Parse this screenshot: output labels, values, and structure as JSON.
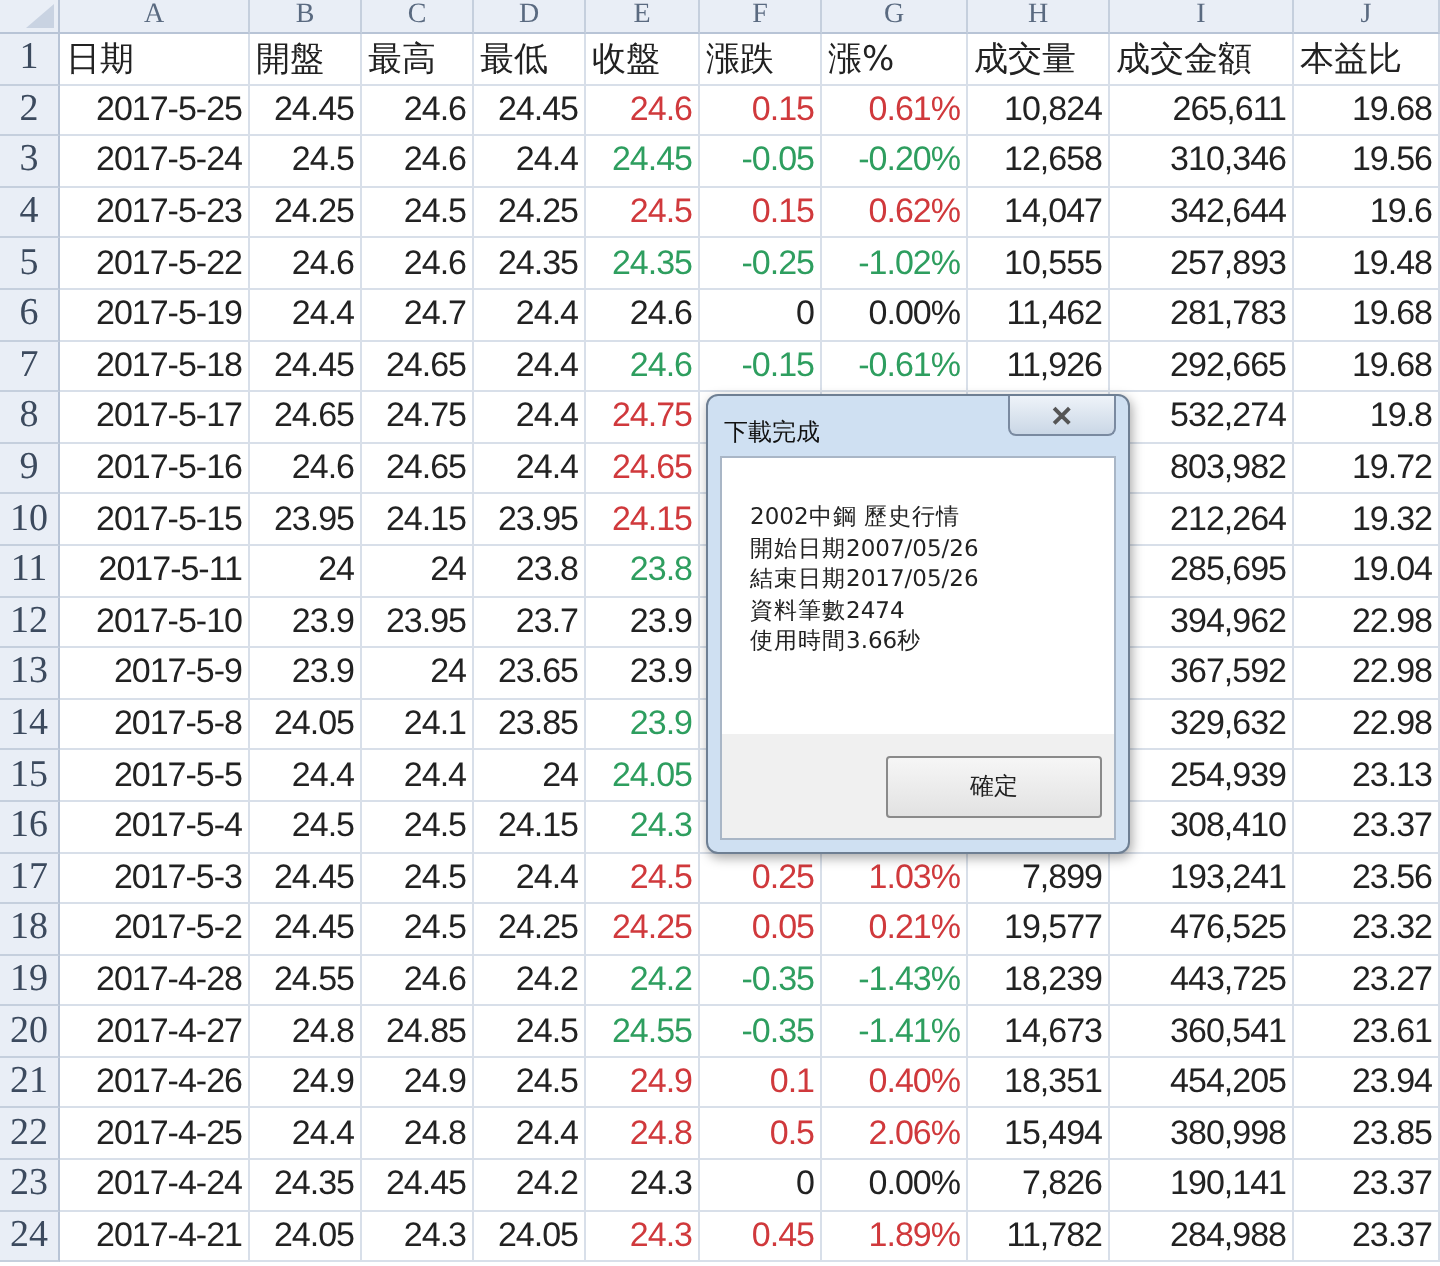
{
  "column_headers": [
    "A",
    "B",
    "C",
    "D",
    "E",
    "F",
    "G",
    "H",
    "I",
    "J"
  ],
  "header_row": {
    "number": "1",
    "cells": [
      "日期",
      "開盤",
      "最高",
      "最低",
      "收盤",
      "漲跌",
      "漲%",
      "成交量",
      "成交金額",
      "本益比"
    ]
  },
  "rows": [
    {
      "number": "2",
      "color": "#d0393c",
      "cells": [
        "2017-5-25",
        "24.45",
        "24.6",
        "24.45",
        "24.6",
        "0.15",
        "0.61%",
        "10,824",
        "265,611",
        "19.68"
      ]
    },
    {
      "number": "3",
      "color": "#2e9e5f",
      "cells": [
        "2017-5-24",
        "24.5",
        "24.6",
        "24.4",
        "24.45",
        "-0.05",
        "-0.20%",
        "12,658",
        "310,346",
        "19.56"
      ]
    },
    {
      "number": "4",
      "color": "#d0393c",
      "cells": [
        "2017-5-23",
        "24.25",
        "24.5",
        "24.25",
        "24.5",
        "0.15",
        "0.62%",
        "14,047",
        "342,644",
        "19.6"
      ]
    },
    {
      "number": "5",
      "color": "#2e9e5f",
      "cells": [
        "2017-5-22",
        "24.6",
        "24.6",
        "24.35",
        "24.35",
        "-0.25",
        "-1.02%",
        "10,555",
        "257,893",
        "19.48"
      ]
    },
    {
      "number": "6",
      "color": "#222222",
      "cells": [
        "2017-5-19",
        "24.4",
        "24.7",
        "24.4",
        "24.6",
        "0",
        "0.00%",
        "11,462",
        "281,783",
        "19.68"
      ]
    },
    {
      "number": "7",
      "color": "#2e9e5f",
      "cells": [
        "2017-5-18",
        "24.45",
        "24.65",
        "24.4",
        "24.6",
        "-0.15",
        "-0.61%",
        "11,926",
        "292,665",
        "19.68"
      ]
    },
    {
      "number": "8",
      "color": "#d0393c",
      "cells": [
        "2017-5-17",
        "24.65",
        "24.75",
        "24.4",
        "24.75",
        null,
        null,
        null,
        "532,274",
        "19.8"
      ]
    },
    {
      "number": "9",
      "color": "#d0393c",
      "cells": [
        "2017-5-16",
        "24.6",
        "24.65",
        "24.4",
        "24.65",
        null,
        null,
        null,
        "803,982",
        "19.72"
      ]
    },
    {
      "number": "10",
      "color": "#d0393c",
      "cells": [
        "2017-5-15",
        "23.95",
        "24.15",
        "23.95",
        "24.15",
        null,
        null,
        null,
        "212,264",
        "19.32"
      ]
    },
    {
      "number": "11",
      "color": "#2e9e5f",
      "cells": [
        "2017-5-11",
        "24",
        "24",
        "23.8",
        "23.8",
        null,
        null,
        null,
        "285,695",
        "19.04"
      ]
    },
    {
      "number": "12",
      "color": "#222222",
      "cells": [
        "2017-5-10",
        "23.9",
        "23.95",
        "23.7",
        "23.9",
        null,
        null,
        null,
        "394,962",
        "22.98"
      ]
    },
    {
      "number": "13",
      "color": "#222222",
      "cells": [
        "2017-5-9",
        "23.9",
        "24",
        "23.65",
        "23.9",
        null,
        null,
        null,
        "367,592",
        "22.98"
      ]
    },
    {
      "number": "14",
      "color": "#2e9e5f",
      "cells": [
        "2017-5-8",
        "24.05",
        "24.1",
        "23.85",
        "23.9",
        null,
        null,
        null,
        "329,632",
        "22.98"
      ]
    },
    {
      "number": "15",
      "color": "#2e9e5f",
      "cells": [
        "2017-5-5",
        "24.4",
        "24.4",
        "24",
        "24.05",
        null,
        null,
        null,
        "254,939",
        "23.13"
      ]
    },
    {
      "number": "16",
      "color": "#2e9e5f",
      "cells": [
        "2017-5-4",
        "24.5",
        "24.5",
        "24.15",
        "24.3",
        null,
        null,
        null,
        "308,410",
        "23.37"
      ]
    },
    {
      "number": "17",
      "color": "#d0393c",
      "cells": [
        "2017-5-3",
        "24.45",
        "24.5",
        "24.4",
        "24.5",
        "0.25",
        "1.03%",
        "7,899",
        "193,241",
        "23.56"
      ]
    },
    {
      "number": "18",
      "color": "#d0393c",
      "cells": [
        "2017-5-2",
        "24.45",
        "24.5",
        "24.25",
        "24.25",
        "0.05",
        "0.21%",
        "19,577",
        "476,525",
        "23.32"
      ]
    },
    {
      "number": "19",
      "color": "#2e9e5f",
      "cells": [
        "2017-4-28",
        "24.55",
        "24.6",
        "24.2",
        "24.2",
        "-0.35",
        "-1.43%",
        "18,239",
        "443,725",
        "23.27"
      ]
    },
    {
      "number": "20",
      "color": "#2e9e5f",
      "cells": [
        "2017-4-27",
        "24.8",
        "24.85",
        "24.5",
        "24.55",
        "-0.35",
        "-1.41%",
        "14,673",
        "360,541",
        "23.61"
      ]
    },
    {
      "number": "21",
      "color": "#d0393c",
      "cells": [
        "2017-4-26",
        "24.9",
        "24.9",
        "24.5",
        "24.9",
        "0.1",
        "0.40%",
        "18,351",
        "454,205",
        "23.94"
      ]
    },
    {
      "number": "22",
      "color": "#d0393c",
      "cells": [
        "2017-4-25",
        "24.4",
        "24.8",
        "24.4",
        "24.8",
        "0.5",
        "2.06%",
        "15,494",
        "380,998",
        "23.85"
      ]
    },
    {
      "number": "23",
      "color": "#222222",
      "cells": [
        "2017-4-24",
        "24.35",
        "24.45",
        "24.2",
        "24.3",
        "0",
        "0.00%",
        "7,826",
        "190,141",
        "23.37"
      ]
    },
    {
      "number": "24",
      "color": "#d0393c",
      "cells": [
        "2017-4-21",
        "24.05",
        "24.3",
        "24.05",
        "24.3",
        "0.45",
        "1.89%",
        "11,782",
        "284,988",
        "23.37"
      ]
    }
  ],
  "dialog": {
    "title": "下載完成",
    "close": "✕",
    "lines": [
      "2002中鋼 歷史行情",
      "開始日期2007/05/26",
      "結束日期2017/05/26",
      "資料筆數2474",
      "使用時間3.66秒"
    ],
    "button": "確定"
  }
}
